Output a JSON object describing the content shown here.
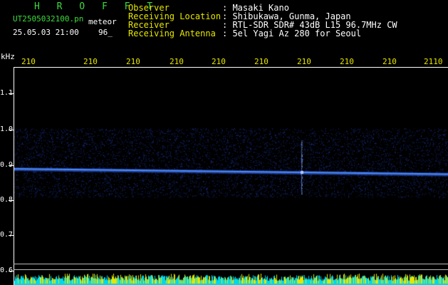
{
  "header": {
    "app_name": "H R O F F T",
    "filename": "UT2505032100.pn",
    "mode_label": "meteor",
    "datetime": "25.05.03 21:00",
    "count": "96_",
    "info": [
      {
        "label": "Observer",
        "value": ": Masaki Kano"
      },
      {
        "label": "Receiving Location",
        "value": ": Shibukawa, Gunma, Japan"
      },
      {
        "label": "Receiver",
        "value": ": RTL-SDR SDR# 43dB L15 96.7MHz CW"
      },
      {
        "label": "Receiving Antenna",
        "value": ": 5el Yagi Az 280 for Seoul"
      }
    ]
  },
  "axes": {
    "y_unit": "kHz",
    "y_ticks": [
      "1.1",
      "1.0",
      "0.9",
      "0.8",
      "0.7",
      "0.6"
    ],
    "x_ticks": [
      "210",
      "210",
      "210",
      "210",
      "210",
      "210",
      "210",
      "210",
      "210",
      "2110"
    ]
  },
  "colors": {
    "background": "#000000",
    "signal": "#4a8cff",
    "noise": "#1a2f9a",
    "activity_yellow": "#e6e600",
    "activity_cyan": "#00d8e8"
  },
  "chart_data": {
    "type": "heatmap",
    "y_unit": "kHz",
    "ylim": [
      0.6,
      1.15
    ],
    "carrier_line": {
      "start_khz": 0.89,
      "end_khz": 0.875
    },
    "meteor_echo_x_index": 7
  }
}
